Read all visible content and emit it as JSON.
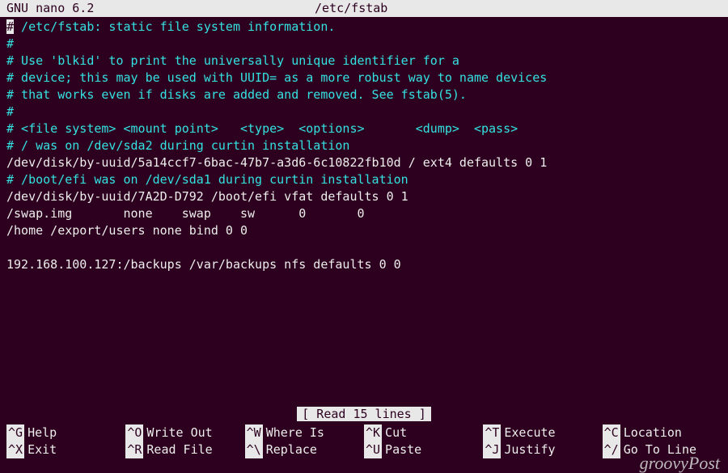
{
  "titlebar": {
    "app": "GNU nano 6.2",
    "filepath": "/etc/fstab"
  },
  "lines": {
    "l1_hash": "#",
    "l1_text": " /etc/fstab: static file system information.",
    "l2": "#",
    "l3_hash": "#",
    "l3_text": " Use 'blkid' to print the universally unique identifier for a",
    "l4_hash": "#",
    "l4_text": " device; this may be used with UUID= as a more robust way to name devices",
    "l5_hash": "#",
    "l5_text": " that works even if disks are added and removed. See fstab(5).",
    "l6": "#",
    "l7_hash": "#",
    "l7_text": " <file system> <mount point>   <type>  <options>       <dump>  <pass>",
    "l8_hash": "#",
    "l8_text": " / was on /dev/sda2 during curtin installation",
    "l9": "/dev/disk/by-uuid/5a14ccf7-6bac-47b7-a3d6-6c10822fb10d / ext4 defaults 0 1",
    "l10_hash": "#",
    "l10_text": " /boot/efi was on /dev/sda1 during curtin installation",
    "l11": "/dev/disk/by-uuid/7A2D-D792 /boot/efi vfat defaults 0 1",
    "l12": "/swap.img       none    swap    sw      0       0",
    "l13": "/home /export/users none bind 0 0",
    "l14": " ",
    "l15": "192.168.100.127:/backups /var/backups nfs defaults 0 0"
  },
  "status": "[ Read 15 lines ]",
  "shortcuts": {
    "r1": {
      "s1": {
        "key": "^G",
        "label": "Help"
      },
      "s2": {
        "key": "^O",
        "label": "Write Out"
      },
      "s3": {
        "key": "^W",
        "label": "Where Is"
      },
      "s4": {
        "key": "^K",
        "label": "Cut"
      },
      "s5": {
        "key": "^T",
        "label": "Execute"
      },
      "s6": {
        "key": "^C",
        "label": "Location"
      }
    },
    "r2": {
      "s1": {
        "key": "^X",
        "label": "Exit"
      },
      "s2": {
        "key": "^R",
        "label": "Read File"
      },
      "s3": {
        "key": "^\\",
        "label": "Replace"
      },
      "s4": {
        "key": "^U",
        "label": "Paste"
      },
      "s5": {
        "key": "^J",
        "label": "Justify"
      },
      "s6": {
        "key": "^/",
        "label": "Go To Line"
      }
    }
  },
  "watermark": "groovyPost"
}
